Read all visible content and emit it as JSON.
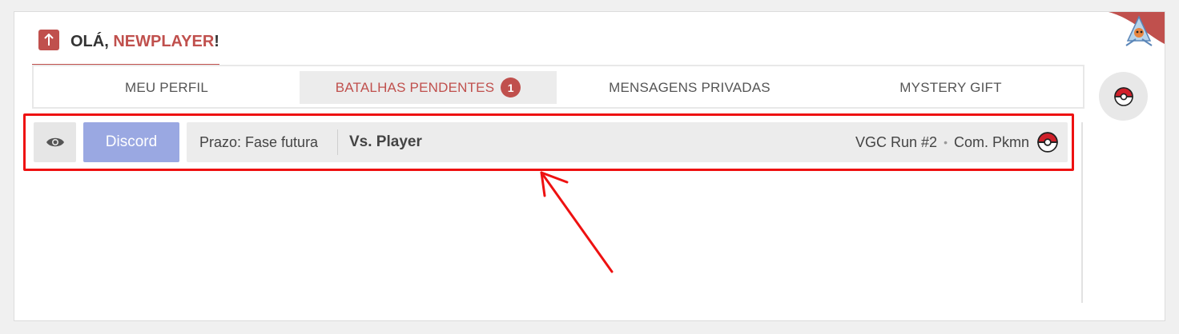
{
  "header": {
    "greeting": "OLÁ,",
    "username": "NEWPLAYER",
    "exclaim": "!"
  },
  "tabs": [
    {
      "label": "MEU PERFIL"
    },
    {
      "label": "BATALHAS PENDENTES",
      "badge": "1"
    },
    {
      "label": "MENSAGENS PRIVADAS"
    },
    {
      "label": "MYSTERY GIFT"
    }
  ],
  "battle": {
    "discord_label": "Discord",
    "deadline": "Prazo: Fase futura",
    "opponent": "Vs. Player",
    "run": "VGC Run #2",
    "separator": "•",
    "community": "Com. Pkmn"
  },
  "icons": {
    "up": "arrow-up-icon",
    "eye": "eye-icon",
    "pokeball": "pokeball-icon",
    "mascot": "pokemon-mascot-icon"
  },
  "colors": {
    "accent": "#c0504d",
    "discord": "#9aa8e2",
    "highlight": "#ee1111"
  }
}
